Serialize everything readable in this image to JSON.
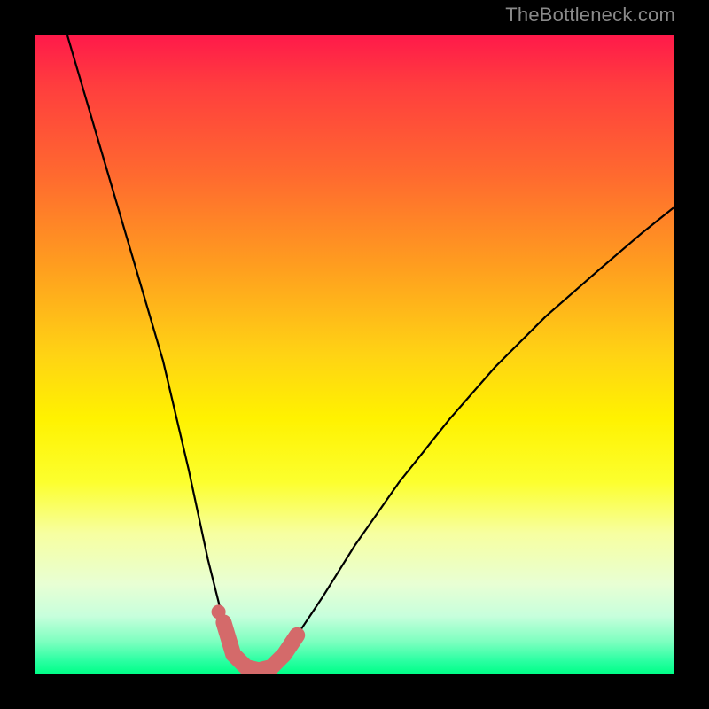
{
  "watermark": "TheBottleneck.com",
  "colors": {
    "frame": "#000000",
    "curve": "#000000",
    "highlight": "#d46a6a",
    "gradient_top": "#ff1a4a",
    "gradient_bottom": "#00ff88"
  },
  "chart_data": {
    "type": "line",
    "title": "",
    "xlabel": "",
    "ylabel": "",
    "xlim": [
      0,
      100
    ],
    "ylim": [
      0,
      100
    ],
    "series": [
      {
        "name": "bottleneck-curve",
        "x": [
          5,
          10,
          15,
          20,
          24,
          27,
          29.5,
          31,
          33,
          35,
          37,
          39,
          41,
          45,
          50,
          57,
          65,
          72,
          80,
          88,
          95,
          100
        ],
        "values": [
          100,
          83,
          66,
          49,
          32,
          18,
          8,
          3,
          1,
          0.5,
          1,
          3,
          6,
          12,
          20,
          30,
          40,
          48,
          56,
          63,
          69,
          73
        ]
      }
    ],
    "highlighted_region": {
      "x_start": 29.5,
      "x_end": 41,
      "description": "near-zero bottleneck bottom of curve marked with thick pink stroke"
    }
  }
}
